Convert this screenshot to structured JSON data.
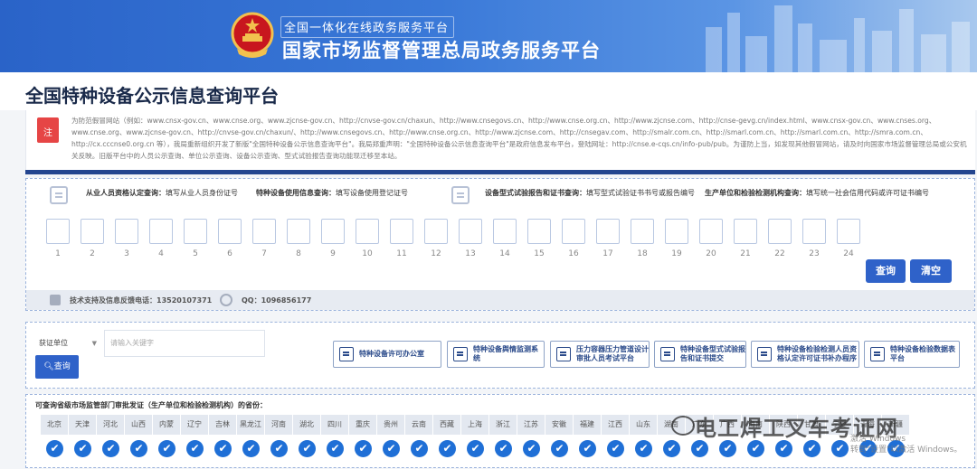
{
  "banner": {
    "subtitle": "全国一体化在线政务服务平台",
    "title": "国家市场监督管理总局政务服务平台"
  },
  "page_title": "全国特种设备公示信息查询平台",
  "notice": {
    "tag": "注",
    "text": "为防范假冒网站（例如：www.cnsx-gov.cn、www.cnse.org、www.zjcnse-gov.cn、http://cnvse-gov.cn/chaxun、http://www.cnsegovs.cn、http://www.cnse.org.cn、http://www.zjcnse.com、http://cnse-gevg.cn/index.html、www.cnsx-gov.cn、www.cnses.org、www.cnse.org、www.zjcnse-gov.cn、http://cnvse-gov.cn/chaxun/、http://www.cnsegovs.cn、http://www.cnse.org.cn、http://www.zjcnse.com、http://cnsegav.com、http://smalr.com.cn、http://smarl.com.cn、http://smarl.com.cn、http://smra.com.cn、http://cx.cccnse0.org.cn 等），我局重新组织开发了新版\"全国特种设备公示信息查询平台\"。我局郑重声明：\"全国特种设备公示信息查询平台\"是政府信息发布平台，登陆网址：http://cnse.e-cqs.cn/info-pub/pub。为谨防上当，如发现其他假冒网站，请及时向国家市场监督管理总局或公安机关反映。旧版平台中的人员公示查询、单位公示查询、设备公示查询、型式试验报告查询功能现迁移至本站。"
  },
  "query": {
    "person_label": "从业人员资格认定查询：",
    "person_hint": "填写从业人员身份证号",
    "device_label": "特种设备使用信息查询：",
    "device_hint": "填写设备使用登记证号",
    "report_label": "设备型式试验报告和证书查询：",
    "report_hint": "填写型式试验证书书号或报告编号",
    "unit_label": "生产单位和检验检测机构查询：",
    "unit_hint": "填写统一社会信用代码或许可证书编号",
    "digits": [
      "1",
      "2",
      "3",
      "4",
      "5",
      "6",
      "7",
      "8",
      "9",
      "10",
      "11",
      "12",
      "13",
      "14",
      "15",
      "16",
      "17",
      "18",
      "19",
      "20",
      "21",
      "22",
      "23",
      "24"
    ],
    "search_button": "查询",
    "clear_button": "清空",
    "support_phone": "技术支持及信息反馈电话：13520107371",
    "support_qq": "QQ：1096856177"
  },
  "tools": {
    "select_value": "获证单位",
    "keyword_placeholder": "请输入关键字",
    "search_button": "查询",
    "links": [
      {
        "label": "特种设备许可办公室",
        "icon": "office-icon"
      },
      {
        "label": "特种设备舆情监测系统",
        "icon": "monitor-icon"
      },
      {
        "label": "压力容器压力管道设计审批人员考试平台",
        "icon": "triangle-icon"
      },
      {
        "label": "特种设备型式试验报告和证书提交",
        "icon": "cube-icon"
      },
      {
        "label": "特种设备检验检测人员资格认定许可证书补办程序",
        "icon": "document-icon"
      },
      {
        "label": "特种设备检验数据表平台",
        "icon": "table-icon"
      }
    ]
  },
  "provinces": {
    "title": "可查询省级市场监管部门审批发证（生产单位和检验检测机构）的省份：",
    "names": [
      "北京",
      "天津",
      "河北",
      "山西",
      "内蒙",
      "辽宁",
      "吉林",
      "黑龙江",
      "河南",
      "湖北",
      "四川",
      "重庆",
      "贵州",
      "云南",
      "西藏",
      "上海",
      "浙江",
      "江苏",
      "安徽",
      "福建",
      "江西",
      "山东",
      "湖南",
      "广东",
      "广西",
      "海南",
      "陕西",
      "甘肃",
      "宁夏",
      "青海",
      "新疆"
    ],
    "check": "✔"
  },
  "overlay": {
    "watermark": "电工焊工叉车考证网",
    "activate_line1": "激活 Windows",
    "activate_line2": "转到\"设置\"以激活 Windows。"
  },
  "colors": {
    "primary": "#2f62c9",
    "navy": "#23458f",
    "banner": "#2a63c8",
    "check": "#1f6fd6"
  }
}
